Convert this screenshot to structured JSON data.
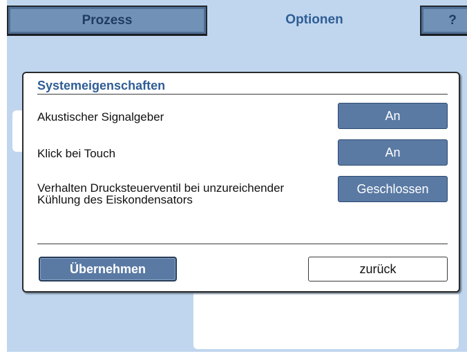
{
  "tabs": {
    "prozess": "Prozess",
    "optionen": "Optionen",
    "help": "?"
  },
  "dialog": {
    "title": "Systemeigenschaften",
    "rows": [
      {
        "label": "Akustischer Signalgeber",
        "value": "An"
      },
      {
        "label": "Klick bei Touch",
        "value": "An"
      },
      {
        "label": "Verhalten Drucksteuerventil bei unzureichender Kühlung des Eiskondensators",
        "value": "Geschlossen"
      }
    ],
    "apply_label": "Übernehmen",
    "back_label": "zurück"
  },
  "colors": {
    "screen_bg": "#c0d6ee",
    "accent_button": "#5a7aa4",
    "title_text": "#2f5d95"
  }
}
